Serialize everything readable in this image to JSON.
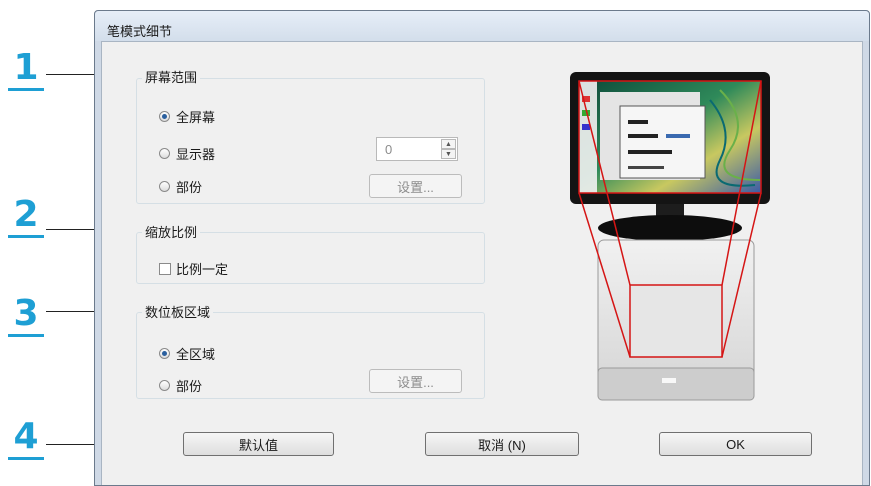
{
  "window": {
    "title": "笔模式细节"
  },
  "callouts": [
    "1",
    "2",
    "3",
    "4"
  ],
  "screen_area": {
    "label": "屏幕范围",
    "options": [
      "全屏幕",
      "显示器",
      "部份"
    ],
    "selected": "全屏幕",
    "monitor_value": "0",
    "settings_label": "设置..."
  },
  "scaling": {
    "label": "缩放比例",
    "proportional_label": "比例一定",
    "proportional_checked": false
  },
  "tablet_area": {
    "label": "数位板区域",
    "options": [
      "全区域",
      "部份"
    ],
    "selected": "全区域",
    "settings_label": "设置..."
  },
  "buttons": {
    "default": "默认值",
    "cancel": "取消 (N)",
    "ok": "OK"
  }
}
